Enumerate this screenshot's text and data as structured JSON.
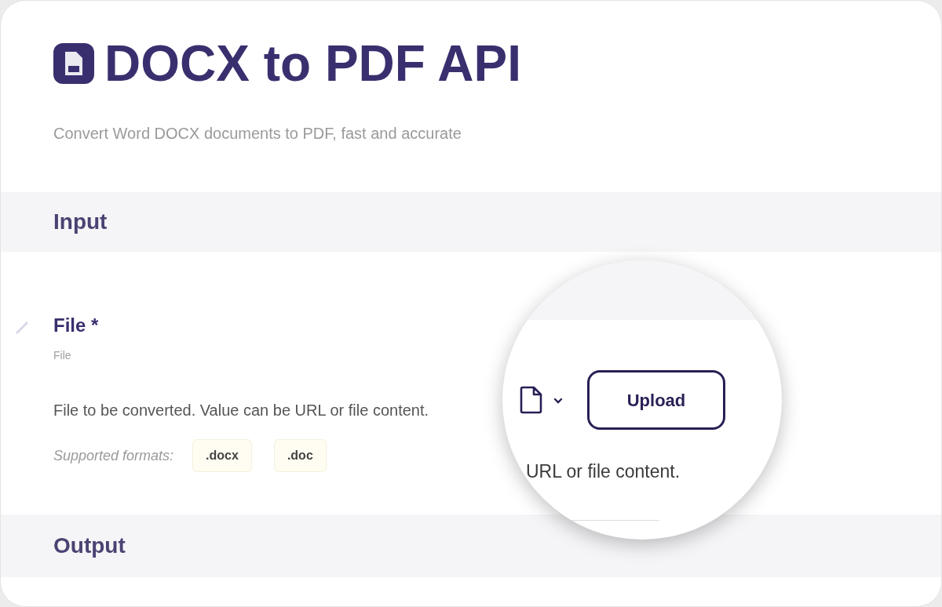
{
  "header": {
    "title": "DOCX to PDF API",
    "subtitle": "Convert Word DOCX documents to PDF, fast and accurate"
  },
  "input_section": {
    "title": "Input",
    "field": {
      "label": "File *",
      "type_hint": "File",
      "description": "File to be converted. Value can be URL or file content.",
      "formats_label": "Supported formats:",
      "formats": [
        ".docx",
        ".doc"
      ]
    }
  },
  "output_section": {
    "title": "Output"
  },
  "magnifier": {
    "upload_button": "Upload",
    "description_fragment": "URL or file content."
  }
}
